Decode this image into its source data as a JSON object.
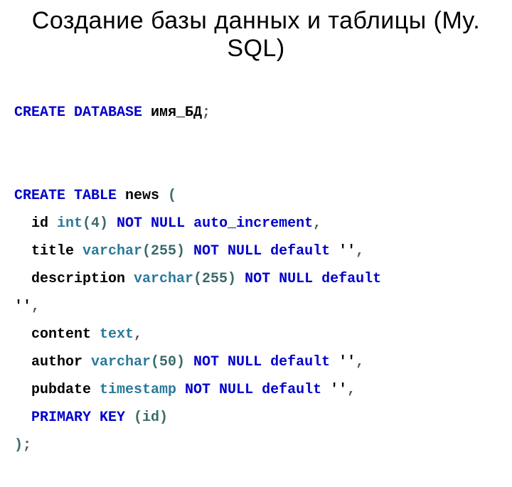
{
  "title": "Создание базы данных и таблицы (My. SQL)",
  "code": {
    "l1_kw": "CREATE DATABASE",
    "l1_id": " имя_БД",
    "l1_sc": ";",
    "l3_kw": "CREATE TABLE",
    "l3_id": " news ",
    "l3_op": "(",
    "l4_col": "id ",
    "l4_ty": "int",
    "l4_p": "(4)",
    "l4_kw": " NOT NULL auto_increment",
    "l4_c": ",",
    "l5_col": "title ",
    "l5_ty": "varchar",
    "l5_p": "(255)",
    "l5_kw": " NOT NULL default",
    "l5_s": " ''",
    "l5_c": ",",
    "l6_col": "description ",
    "l6_ty": "varchar",
    "l6_p": "(255)",
    "l6_kw": " NOT NULL default",
    "l6_s2": "''",
    "l6_c": ",",
    "l7_col": "content ",
    "l7_ty": "text",
    "l7_c": ",",
    "l8_col": "author ",
    "l8_ty": "varchar",
    "l8_p": "(50)",
    "l8_kw": " NOT NULL default",
    "l8_s": " ''",
    "l8_c": ",",
    "l9_col": "pubdate ",
    "l9_ty": "timestamp",
    "l9_kw": " NOT NULL default",
    "l9_s": " ''",
    "l9_c": ",",
    "l10_kw": "PRIMARY KEY",
    "l10_p": " (id)",
    "l11_cp": ")",
    "l11_sc": ";"
  }
}
